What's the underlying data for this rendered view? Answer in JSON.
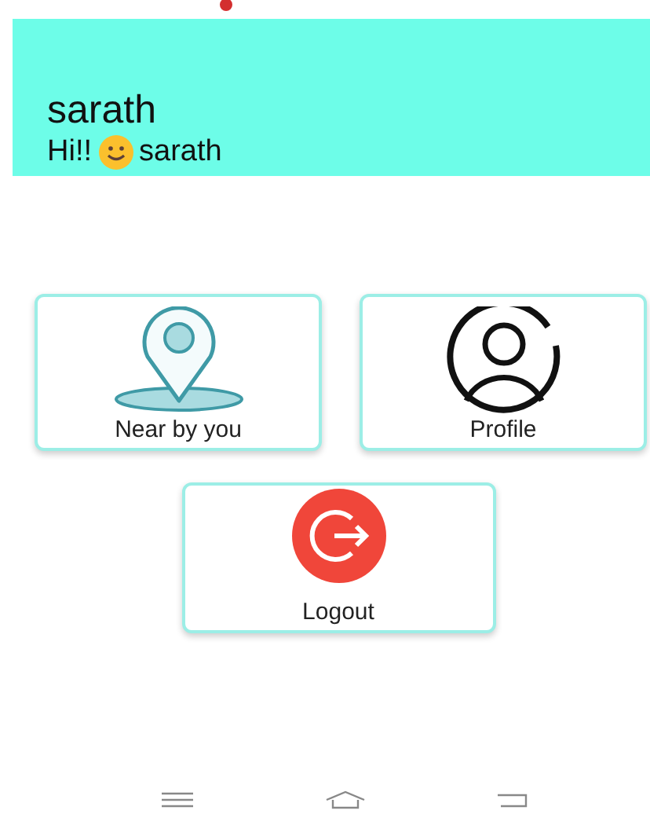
{
  "header": {
    "name": "sarath",
    "greeting": "Hi!!",
    "greeting_name": "sarath"
  },
  "tiles": [
    {
      "kind": "pin",
      "label": "Near by you"
    },
    {
      "kind": "person",
      "label": "Profile"
    },
    {
      "kind": "logout",
      "label": "Logout"
    }
  ]
}
